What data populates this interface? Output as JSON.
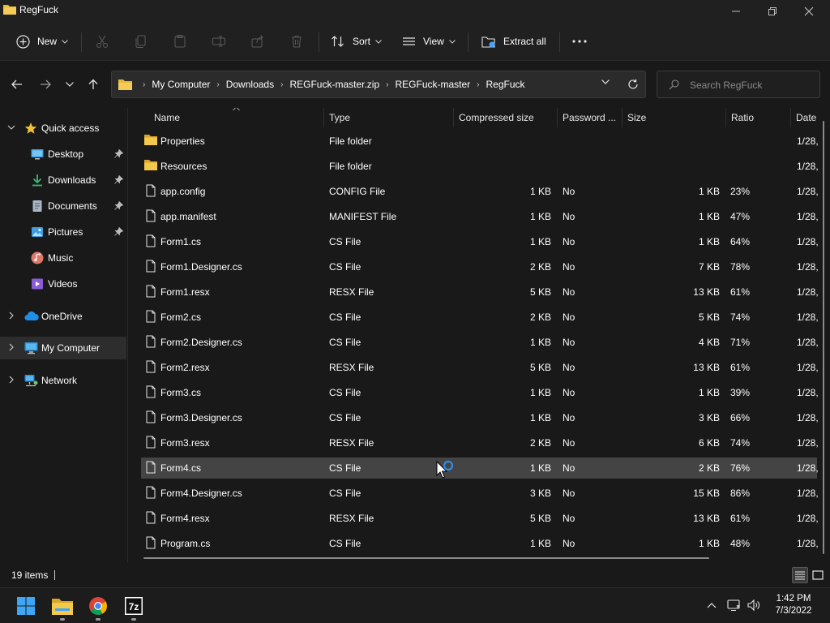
{
  "window": {
    "title": "RegFuck"
  },
  "toolbar": {
    "new_label": "New",
    "sort_label": "Sort",
    "view_label": "View",
    "extract_all_label": "Extract all"
  },
  "address": {
    "crumbs": [
      "My Computer",
      "Downloads",
      "REGFuck-master.zip",
      "REGFuck-master",
      "RegFuck"
    ]
  },
  "search": {
    "placeholder": "Search RegFuck"
  },
  "sidebar": {
    "items": [
      {
        "label": "Quick access",
        "icon": "star-icon"
      },
      {
        "label": "Desktop",
        "icon": "desktop-icon",
        "pinned": true
      },
      {
        "label": "Downloads",
        "icon": "download-icon",
        "pinned": true
      },
      {
        "label": "Documents",
        "icon": "documents-icon",
        "pinned": true
      },
      {
        "label": "Pictures",
        "icon": "pictures-icon",
        "pinned": true
      },
      {
        "label": "Music",
        "icon": "music-icon"
      },
      {
        "label": "Videos",
        "icon": "videos-icon"
      },
      {
        "label": "OneDrive",
        "icon": "cloud-icon"
      },
      {
        "label": "My Computer",
        "icon": "computer-icon",
        "selected": true
      },
      {
        "label": "Network",
        "icon": "network-icon"
      }
    ]
  },
  "columns": {
    "name": "Name",
    "type": "Type",
    "compressed": "Compressed size",
    "password": "Password ...",
    "size": "Size",
    "ratio": "Ratio",
    "date": "Date"
  },
  "files": [
    {
      "name": "Properties",
      "type": "File folder",
      "compressed": "",
      "password": "",
      "size": "",
      "ratio": "",
      "date": "1/28,",
      "folder": true
    },
    {
      "name": "Resources",
      "type": "File folder",
      "compressed": "",
      "password": "",
      "size": "",
      "ratio": "",
      "date": "1/28,",
      "folder": true
    },
    {
      "name": "app.config",
      "type": "CONFIG File",
      "compressed": "1 KB",
      "password": "No",
      "size": "1 KB",
      "ratio": "23%",
      "date": "1/28,"
    },
    {
      "name": "app.manifest",
      "type": "MANIFEST File",
      "compressed": "1 KB",
      "password": "No",
      "size": "1 KB",
      "ratio": "47%",
      "date": "1/28,"
    },
    {
      "name": "Form1.cs",
      "type": "CS File",
      "compressed": "1 KB",
      "password": "No",
      "size": "1 KB",
      "ratio": "64%",
      "date": "1/28,"
    },
    {
      "name": "Form1.Designer.cs",
      "type": "CS File",
      "compressed": "2 KB",
      "password": "No",
      "size": "7 KB",
      "ratio": "78%",
      "date": "1/28,"
    },
    {
      "name": "Form1.resx",
      "type": "RESX File",
      "compressed": "5 KB",
      "password": "No",
      "size": "13 KB",
      "ratio": "61%",
      "date": "1/28,"
    },
    {
      "name": "Form2.cs",
      "type": "CS File",
      "compressed": "2 KB",
      "password": "No",
      "size": "5 KB",
      "ratio": "74%",
      "date": "1/28,"
    },
    {
      "name": "Form2.Designer.cs",
      "type": "CS File",
      "compressed": "1 KB",
      "password": "No",
      "size": "4 KB",
      "ratio": "71%",
      "date": "1/28,"
    },
    {
      "name": "Form2.resx",
      "type": "RESX File",
      "compressed": "5 KB",
      "password": "No",
      "size": "13 KB",
      "ratio": "61%",
      "date": "1/28,"
    },
    {
      "name": "Form3.cs",
      "type": "CS File",
      "compressed": "1 KB",
      "password": "No",
      "size": "1 KB",
      "ratio": "39%",
      "date": "1/28,"
    },
    {
      "name": "Form3.Designer.cs",
      "type": "CS File",
      "compressed": "1 KB",
      "password": "No",
      "size": "3 KB",
      "ratio": "66%",
      "date": "1/28,"
    },
    {
      "name": "Form3.resx",
      "type": "RESX File",
      "compressed": "2 KB",
      "password": "No",
      "size": "6 KB",
      "ratio": "74%",
      "date": "1/28,"
    },
    {
      "name": "Form4.cs",
      "type": "CS File",
      "compressed": "1 KB",
      "password": "No",
      "size": "2 KB",
      "ratio": "76%",
      "date": "1/28,",
      "selected": true
    },
    {
      "name": "Form4.Designer.cs",
      "type": "CS File",
      "compressed": "3 KB",
      "password": "No",
      "size": "15 KB",
      "ratio": "86%",
      "date": "1/28,"
    },
    {
      "name": "Form4.resx",
      "type": "RESX File",
      "compressed": "5 KB",
      "password": "No",
      "size": "13 KB",
      "ratio": "61%",
      "date": "1/28,"
    },
    {
      "name": "Program.cs",
      "type": "CS File",
      "compressed": "1 KB",
      "password": "No",
      "size": "1 KB",
      "ratio": "48%",
      "date": "1/28,"
    }
  ],
  "status": {
    "count": "19 items"
  },
  "taskbar": {
    "apps": [
      "windows-start-icon",
      "file-explorer-icon",
      "chrome-icon",
      "7zip-icon"
    ],
    "time": "1:42 PM",
    "date": "7/3/2022"
  },
  "colors": {
    "background": "#191919",
    "chrome": "#202020",
    "selected_row": "#444444",
    "folder_yellow": "#e8b93c",
    "accent_blue": "#4aa3ff"
  }
}
